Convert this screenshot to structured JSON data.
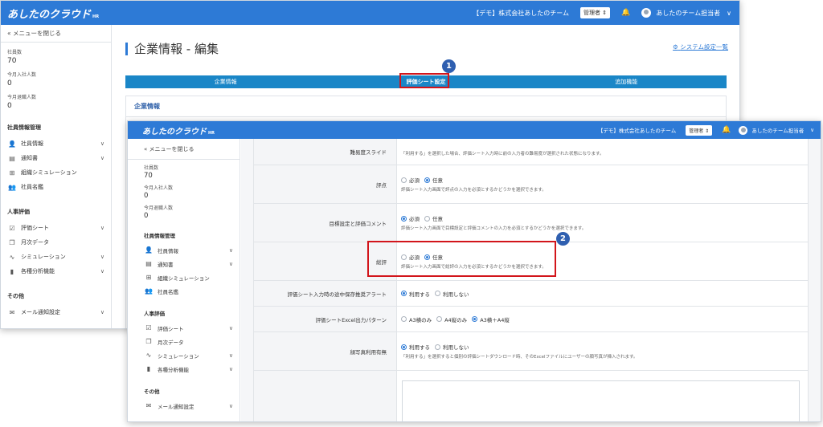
{
  "brand": {
    "name": "あしたのクラウド",
    "suffix": "HR"
  },
  "topbar": {
    "company": "【デモ】株式会社あしたのチーム",
    "role_label": "管理者",
    "role_arrow": "⇕",
    "bell_icon": "🔔",
    "user_name": "あしたのチーム担当者",
    "chevron": "∨"
  },
  "sidebar": {
    "close_menu": "メニューを閉じる",
    "close_icon": "«",
    "stats": [
      {
        "label": "社員数",
        "value": "70"
      },
      {
        "label": "今月入社人数",
        "value": "0"
      },
      {
        "label": "今月退職人数",
        "value": "0"
      }
    ],
    "sections": [
      {
        "title": "社員情報管理",
        "items": [
          {
            "label": "社員情報",
            "icon": "👤",
            "arrow": "∨"
          },
          {
            "label": "通知書",
            "icon": "▤",
            "arrow": "∨"
          },
          {
            "label": "組織シミュレーション",
            "icon": "⊞",
            "arrow": ""
          },
          {
            "label": "社員名鑑",
            "icon": "👥",
            "arrow": ""
          }
        ]
      },
      {
        "title": "人事評価",
        "items": [
          {
            "label": "評価シート",
            "icon": "☑",
            "arrow": "∨"
          },
          {
            "label": "月次データ",
            "icon": "❐",
            "arrow": ""
          },
          {
            "label": "シミュレーション",
            "icon": "∿",
            "arrow": "∨"
          },
          {
            "label": "各種分析機能",
            "icon": "▮",
            "arrow": "∨"
          }
        ]
      },
      {
        "title": "その他",
        "items": [
          {
            "label": "メール通知設定",
            "icon": "✉",
            "arrow": "∨"
          }
        ]
      }
    ]
  },
  "page": {
    "title": "企業情報 - 編集",
    "system_link": "システム設定一覧",
    "gear_icon": "⚙",
    "tabs": [
      "企業情報",
      "評価シート設定",
      "追加機能"
    ],
    "panel_title": "企業情報"
  },
  "settings": {
    "rows": [
      {
        "label": "難易度スライド",
        "note": "「利用する」を選択した場合、評価シート入力時に前の入力者の難易度が選択された状態になります。",
        "options": []
      },
      {
        "label": "評点",
        "options": [
          {
            "text": "必須",
            "on": false
          },
          {
            "text": "任意",
            "on": true
          }
        ],
        "note": "評価シート入力画面で評点の入力を必須とするかどうかを選択できます。"
      },
      {
        "label": "目標設定と評価コメント",
        "options": [
          {
            "text": "必須",
            "on": true
          },
          {
            "text": "任意",
            "on": false
          }
        ],
        "note": "評価シート入力画面で目標設定と評価コメントの入力を必須とするかどうかを選択できます。"
      },
      {
        "label": "総評",
        "options": [
          {
            "text": "必須",
            "on": false
          },
          {
            "text": "任意",
            "on": true
          }
        ],
        "note": "評価シート入力画面で総評の入力を必須とするかどうかを選択できます。"
      },
      {
        "label": "評価シート入力時の途中保存推奨アラート",
        "options": [
          {
            "text": "利用する",
            "on": true
          },
          {
            "text": "利用しない",
            "on": false
          }
        ],
        "note": ""
      },
      {
        "label": "評価シートExcel出力パターン",
        "options": [
          {
            "text": "A3横のみ",
            "on": false
          },
          {
            "text": "A4縦のみ",
            "on": false
          },
          {
            "text": "A3横＋A4縦",
            "on": true
          }
        ],
        "note": ""
      },
      {
        "label": "顔写真利用有無",
        "options": [
          {
            "text": "利用する",
            "on": true
          },
          {
            "text": "利用しない",
            "on": false
          }
        ],
        "note": "「利用する」を選択すると個別の評価シートダウンロード時、そのExcelファイルにユーザーの顔写真が挿入されます。"
      }
    ]
  },
  "annotations": {
    "badge1": "1",
    "badge2": "2"
  }
}
